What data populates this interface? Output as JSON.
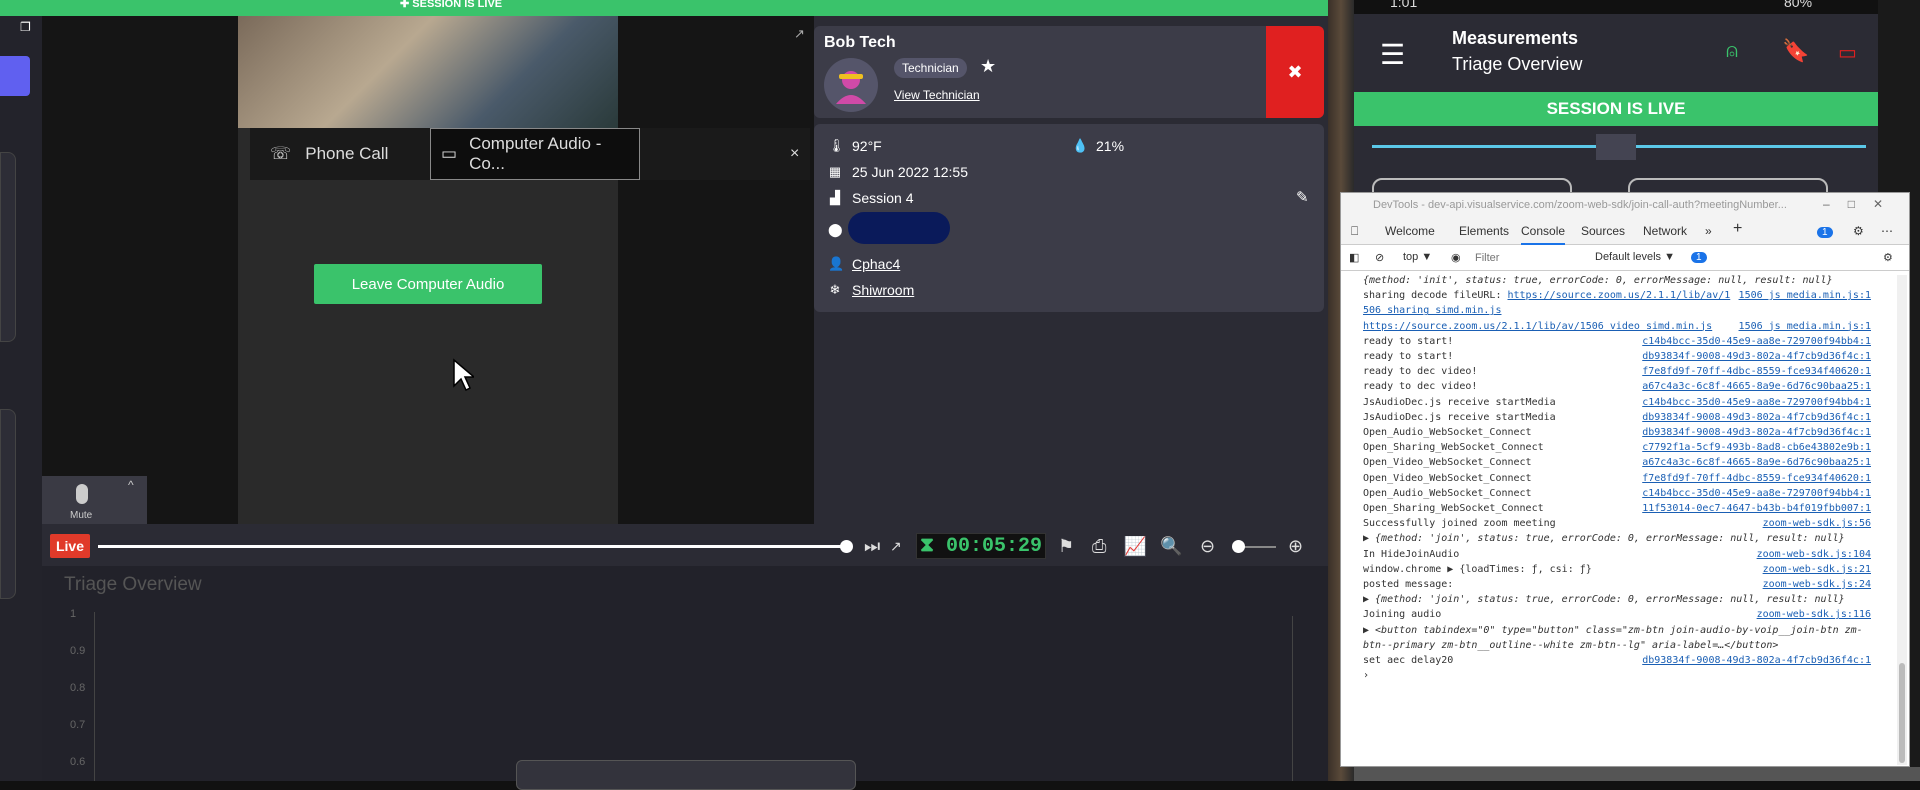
{
  "left_app": {
    "top_banner": "✚ SESSION IS LIVE",
    "audio": {
      "phone_call_label": "Phone Call",
      "computer_audio_label": "Computer Audio - Co...",
      "leave_button": "Leave Computer Audio",
      "mute_label": "Mute",
      "close": "×"
    },
    "technician": {
      "name": "Bob Tech",
      "role_badge": "Technician",
      "view_link": "View Technician"
    },
    "info": {
      "temperature": "92°F",
      "humidity": "21%",
      "datetime": "25 Jun 2022 12:55",
      "session": "Session 4",
      "device": "Cphac4",
      "room": "Shiwroom"
    },
    "timeline": {
      "live_badge": "Live",
      "timer": "⧗ 00:05:29"
    },
    "chart": {
      "title": "Triage Overview",
      "y_ticks": [
        "1",
        "0.9",
        "0.8",
        "0.7",
        "0.6"
      ]
    }
  },
  "phone": {
    "status_time": "1:01",
    "battery": "80%",
    "header_title": "Measurements",
    "header_subtitle": "Triage Overview",
    "live_banner": "SESSION IS LIVE"
  },
  "devtools": {
    "title": "DevTools - dev-api.visualservice.com/zoom-web-sdk/join-call-auth?meetingNumber...",
    "tabs": [
      "Welcome",
      "Elements",
      "Console",
      "Sources",
      "Network",
      "»"
    ],
    "issue_count": "1",
    "context": "top ▼",
    "filter_placeholder": "Filter",
    "levels": "Default levels ▼",
    "log": [
      {
        "msg": "{method: 'init', status: true, errorCode: 0, errorMessage: null, result: null}",
        "src": "",
        "type": "obj"
      },
      {
        "msg": "sharing decode fileURL: ",
        "url": "https://source.zoom.us/2.1.1/lib/av/1",
        "src": "1506 js media.min.js:1"
      },
      {
        "msg": "",
        "url": "506 sharing simd.min.js",
        "src": ""
      },
      {
        "msg": "",
        "url": "https://source.zoom.us/2.1.1/lib/av/1506 video simd.min.js",
        "src": "1506 js media.min.js:1"
      },
      {
        "msg": "ready to start!",
        "src": "c14b4bcc-35d0-45e9-aa8e-729700f94bb4:1"
      },
      {
        "msg": "ready to start!",
        "src": "db93834f-9008-49d3-802a-4f7cb9d36f4c:1"
      },
      {
        "msg": "ready to dec video!",
        "src": "f7e8fd9f-70ff-4dbc-8559-fce934f40620:1"
      },
      {
        "msg": "ready to dec video!",
        "src": "a67c4a3c-6c8f-4665-8a9e-6d76c90baa25:1"
      },
      {
        "msg": "JsAudioDec.js receive startMedia",
        "src": "c14b4bcc-35d0-45e9-aa8e-729700f94bb4:1"
      },
      {
        "msg": "JsAudioDec.js receive startMedia",
        "src": "db93834f-9008-49d3-802a-4f7cb9d36f4c:1"
      },
      {
        "msg": "Open_Audio_WebSocket_Connect",
        "src": "db93834f-9008-49d3-802a-4f7cb9d36f4c:1"
      },
      {
        "msg": "Open_Sharing_WebSocket_Connect",
        "src": "c7792f1a-5cf9-493b-8ad8-cb6e43802e9b:1"
      },
      {
        "msg": "Open_Video_WebSocket_Connect",
        "src": "a67c4a3c-6c8f-4665-8a9e-6d76c90baa25:1"
      },
      {
        "msg": "Open_Video_WebSocket_Connect",
        "src": "f7e8fd9f-70ff-4dbc-8559-fce934f40620:1"
      },
      {
        "msg": "Open_Audio_WebSocket_Connect",
        "src": "c14b4bcc-35d0-45e9-aa8e-729700f94bb4:1"
      },
      {
        "msg": "Open_Sharing_WebSocket_Connect",
        "src": "11f53014-0ec7-4647-b43b-b4f019fbb007:1"
      },
      {
        "msg": "Successfully joined zoom meeting",
        "src": "zoom-web-sdk.js:56"
      },
      {
        "msg": "▶ {method: 'join', status: true, errorCode: 0, errorMessage: null, result: null}",
        "src": "",
        "type": "obj"
      },
      {
        "msg": "In HideJoinAudio",
        "src": "zoom-web-sdk.js:104"
      },
      {
        "msg": "window.chrome ▶ {loadTimes: ƒ, csi: ƒ}",
        "src": "zoom-web-sdk.js:21"
      },
      {
        "msg": "posted message:",
        "src": "zoom-web-sdk.js:24"
      },
      {
        "msg": "▶ {method: 'join', status: true, errorCode: 0, errorMessage: null, result: null}",
        "src": "",
        "type": "obj"
      },
      {
        "msg": "Joining audio",
        "src": "zoom-web-sdk.js:116"
      },
      {
        "msg": "▶ <button tabindex=\"0\" type=\"button\" class=\"zm-btn join-audio-by-voip__join-btn zm-",
        "src": "",
        "type": "obj"
      },
      {
        "msg": "  btn--primary zm-btn__outline--white zm-btn--lg\" aria-label=…</button>",
        "src": "",
        "type": "obj"
      },
      {
        "msg": "set aec delay20",
        "src": "db93834f-9008-49d3-802a-4f7cb9d36f4c:1"
      },
      {
        "msg": "›",
        "src": ""
      }
    ]
  },
  "colors": {
    "accent_green": "#3ac36b",
    "live_red": "#e03a2a",
    "end_call_red": "#e02020",
    "link_blue": "#1a5fb4"
  }
}
